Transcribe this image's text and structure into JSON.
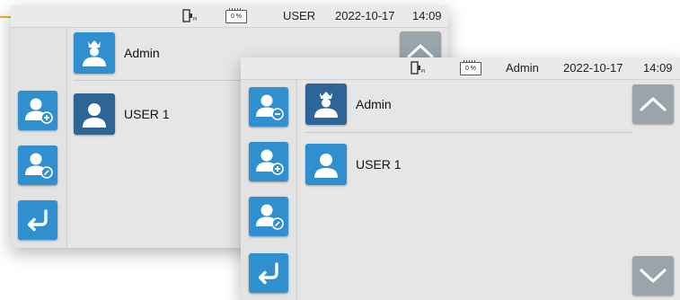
{
  "back_screen": {
    "status": {
      "battery": "0 %",
      "user": "USER",
      "date": "2022-10-17",
      "time": "14:09"
    },
    "users": [
      {
        "name": "Admin",
        "icon": "admin-crown-icon"
      },
      {
        "name": "USER 1",
        "icon": "user-icon"
      }
    ],
    "sidebar": [
      "add-user-icon",
      "edit-user-icon",
      "back-arrow-icon"
    ]
  },
  "front_screen": {
    "status": {
      "battery": "0 %",
      "user": "Admin",
      "date": "2022-10-17",
      "time": "14:09"
    },
    "users": [
      {
        "name": "Admin",
        "icon": "admin-crown-icon"
      },
      {
        "name": "USER 1",
        "icon": "user-icon"
      }
    ],
    "sidebar": [
      "remove-user-icon",
      "add-user-icon",
      "edit-user-icon",
      "back-arrow-icon"
    ]
  },
  "colors": {
    "accent": "#f0b323",
    "button_blue": "#2f8fcf",
    "selected_blue": "#2c6596",
    "scroll_gray": "#9aa4ab"
  }
}
